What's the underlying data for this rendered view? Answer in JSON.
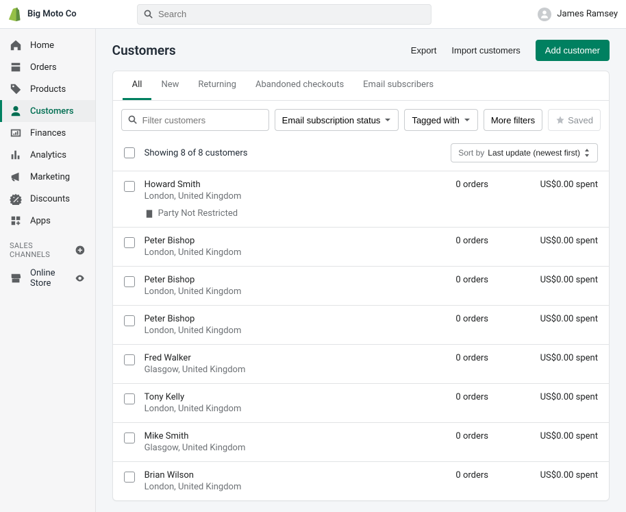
{
  "store_name": "Big Moto Co",
  "search_placeholder": "Search",
  "user_name": "James Ramsey",
  "nav": {
    "home": "Home",
    "orders": "Orders",
    "products": "Products",
    "customers": "Customers",
    "finances": "Finances",
    "analytics": "Analytics",
    "marketing": "Marketing",
    "discounts": "Discounts",
    "apps": "Apps",
    "sales_channels": "SALES CHANNELS",
    "online_store": "Online Store"
  },
  "page_title": "Customers",
  "actions": {
    "export": "Export",
    "import": "Import customers",
    "add": "Add customer"
  },
  "tabs": {
    "all": "All",
    "new": "New",
    "returning": "Returning",
    "abandoned": "Abandoned checkouts",
    "subscribers": "Email subscribers"
  },
  "filters": {
    "placeholder": "Filter customers",
    "email_sub": "Email subscription status",
    "tagged": "Tagged with",
    "more": "More filters",
    "saved": "Saved"
  },
  "showing": "Showing 8 of 8 customers",
  "sort": {
    "label": "Sort by",
    "value": "Last update (newest first)"
  },
  "customers": [
    {
      "name": "Howard Smith",
      "location": "London, United Kingdom",
      "orders": "0 orders",
      "spent": "US$0.00 spent",
      "note": "Party Not Restricted"
    },
    {
      "name": "Peter Bishop",
      "location": "London, United Kingdom",
      "orders": "0 orders",
      "spent": "US$0.00 spent"
    },
    {
      "name": "Peter Bishop",
      "location": "London, United Kingdom",
      "orders": "0 orders",
      "spent": "US$0.00 spent"
    },
    {
      "name": "Peter Bishop",
      "location": "London, United Kingdom",
      "orders": "0 orders",
      "spent": "US$0.00 spent"
    },
    {
      "name": "Fred Walker",
      "location": "Glasgow, United Kingdom",
      "orders": "0 orders",
      "spent": "US$0.00 spent"
    },
    {
      "name": "Tony Kelly",
      "location": "London, United Kingdom",
      "orders": "0 orders",
      "spent": "US$0.00 spent"
    },
    {
      "name": "Mike Smith",
      "location": "Glasgow, United Kingdom",
      "orders": "0 orders",
      "spent": "US$0.00 spent"
    },
    {
      "name": "Brian Wilson",
      "location": "London, United Kingdom",
      "orders": "0 orders",
      "spent": "US$0.00 spent"
    }
  ]
}
